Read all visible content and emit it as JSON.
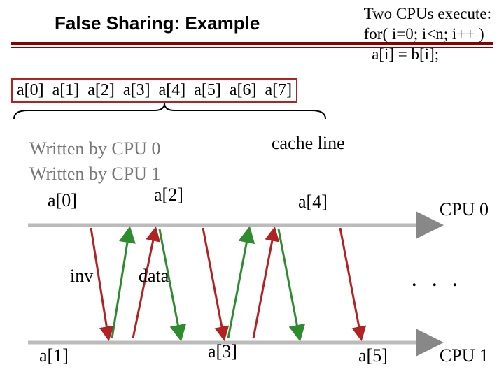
{
  "title": "False Sharing: Example",
  "code": {
    "l1": "Two CPUs execute:",
    "l2": "for( i=0; i<n; i++ )",
    "l3": "  a[i] = b[i];"
  },
  "cells": [
    "a[0]",
    "a[1]",
    "a[2]",
    "a[3]",
    "a[4]",
    "a[5]",
    "a[6]",
    "a[7]"
  ],
  "written0": "Written by CPU 0",
  "written1": "Written by CPU 1",
  "cacheline": "cache line",
  "top": {
    "a0": "a[0]",
    "a2": "a[2]",
    "a4": "a[4]"
  },
  "bot": {
    "a1": "a[1]",
    "a3": "a[3]",
    "a5": "a[5]"
  },
  "cpu0": "CPU 0",
  "cpu1": "CPU 1",
  "inv": "inv",
  "data": "data",
  "dots": ". . ."
}
